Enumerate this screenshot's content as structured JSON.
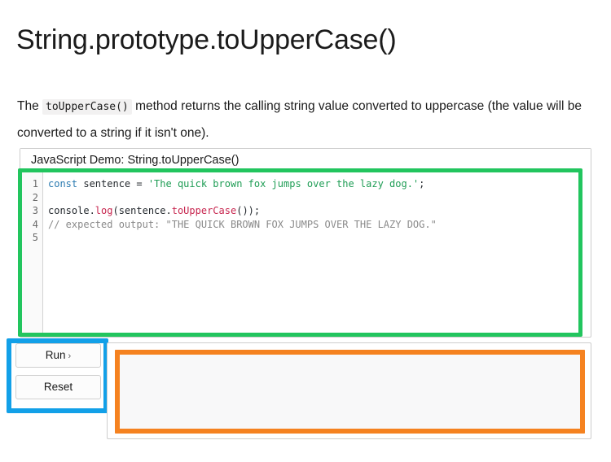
{
  "page": {
    "title": "String.prototype.toUpperCase()"
  },
  "intro": {
    "before_code": "The ",
    "inline_code": "toUpperCase()",
    "after_code": " method returns the calling string value converted to uppercase (the value will be converted to a string if it isn't one)."
  },
  "editor": {
    "header": "JavaScript Demo: String.toUpperCase()",
    "line_numbers": [
      "1",
      "2",
      "3",
      "4",
      "5"
    ],
    "lines": [
      {
        "tokens": [
          {
            "text": "const",
            "kind": "kw"
          },
          {
            "text": " sentence = ",
            "kind": "plain"
          },
          {
            "text": "'The quick brown fox jumps over the lazy dog.'",
            "kind": "str"
          },
          {
            "text": ";",
            "kind": "plain"
          }
        ]
      },
      {
        "tokens": []
      },
      {
        "tokens": [
          {
            "text": "console.",
            "kind": "plain"
          },
          {
            "text": "log",
            "kind": "fn"
          },
          {
            "text": "(sentence.",
            "kind": "plain"
          },
          {
            "text": "toUpperCase",
            "kind": "fn"
          },
          {
            "text": "());",
            "kind": "plain"
          }
        ]
      },
      {
        "tokens": [
          {
            "text": "// expected output: \"THE QUICK BROWN FOX JUMPS OVER THE LAZY DOG.\"",
            "kind": "comment"
          }
        ]
      },
      {
        "tokens": []
      }
    ]
  },
  "controls": {
    "run_label": "Run",
    "run_chevron": "›",
    "reset_label": "Reset"
  },
  "output": {
    "text": ""
  },
  "highlights": {
    "code_box_color": "#22c55e",
    "controls_box_color": "#12a0e8",
    "output_box_color": "#f58220"
  }
}
